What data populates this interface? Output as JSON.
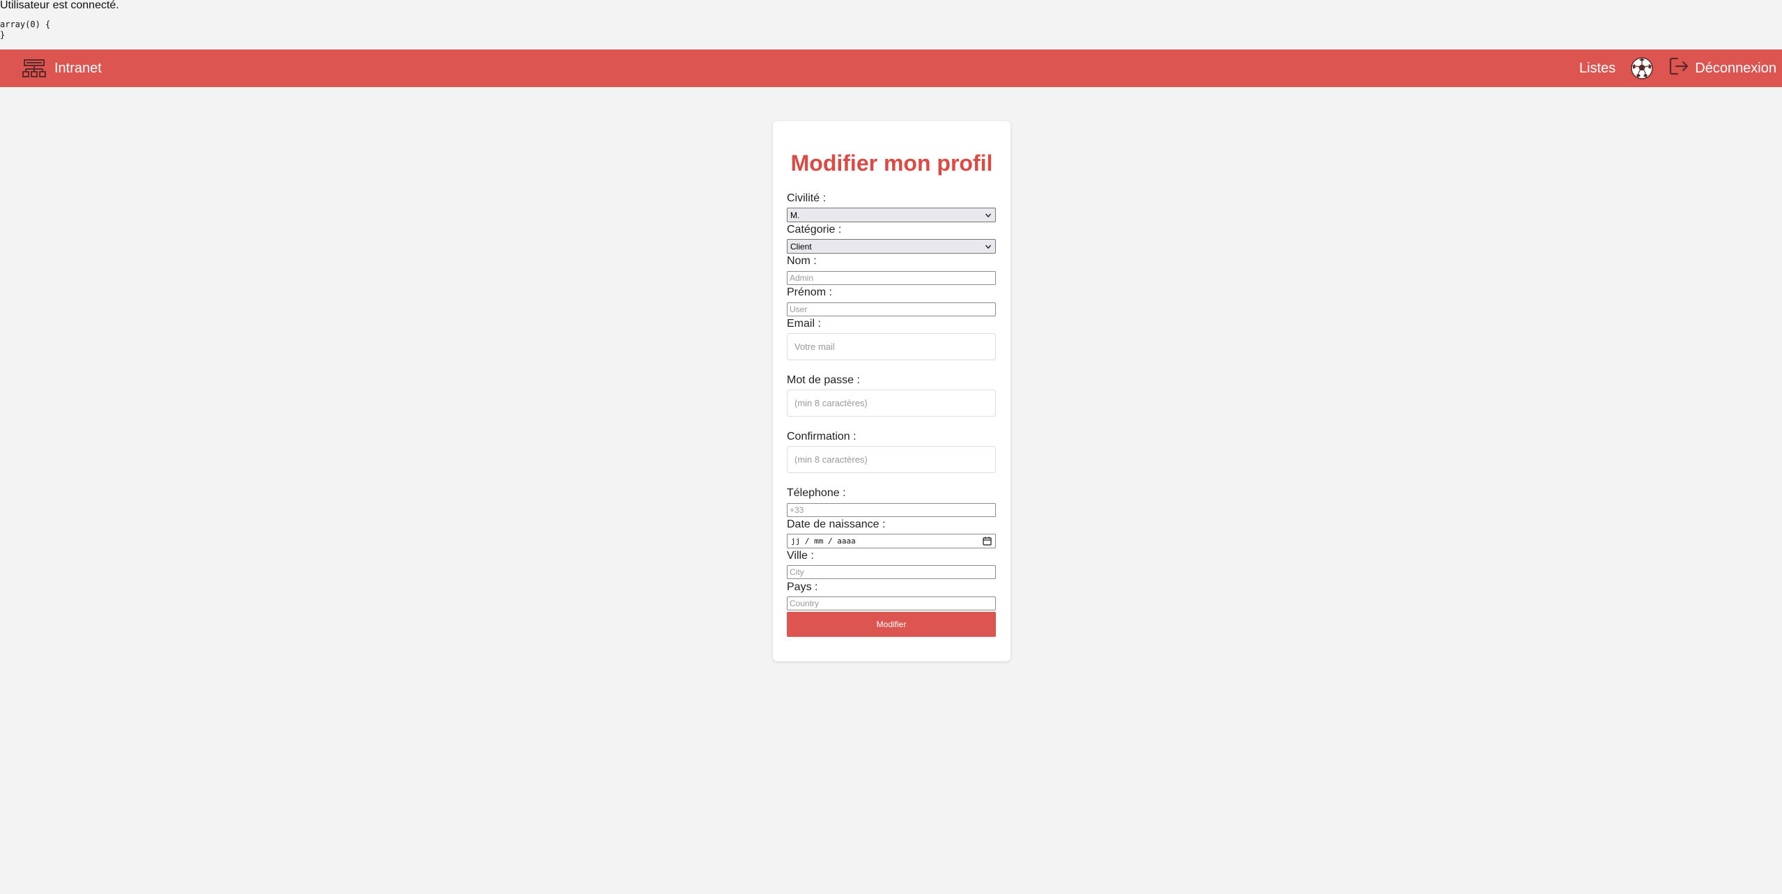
{
  "debug": {
    "status_text": "Utilisateur est connecté.",
    "dump_text": "array(0) {\n}"
  },
  "navbar": {
    "brand_icon": "sitemap-icon",
    "brand_label": "Intranet",
    "lists_label": "Listes",
    "avatar_icon": "soccer-ball-icon",
    "logout_icon": "logout-icon",
    "logout_label": "Déconnexion",
    "background_color": "#dd5550"
  },
  "form": {
    "title": "Modifier mon profil",
    "title_color": "#dd4a44",
    "fields": {
      "civilite": {
        "label": "Civilité :",
        "value": "M."
      },
      "categorie": {
        "label": "Catégorie :",
        "value": "Client"
      },
      "nom": {
        "label": "Nom :",
        "placeholder": "Admin"
      },
      "prenom": {
        "label": "Prénom :",
        "placeholder": "User"
      },
      "email": {
        "label": "Email :",
        "placeholder": "Votre mail"
      },
      "mot_de_passe": {
        "label": "Mot de passe :",
        "placeholder": "(min 8 caractères)"
      },
      "confirmation": {
        "label": "Confirmation :",
        "placeholder": "(min 8 caractères)"
      },
      "telephone": {
        "label": "Télephone :",
        "placeholder": "+33"
      },
      "date_naissance": {
        "label": "Date de naissance :",
        "placeholder": "jj / mm / aaaa"
      },
      "ville": {
        "label": "Ville :",
        "placeholder": "City"
      },
      "pays": {
        "label": "Pays :",
        "placeholder": "Country"
      }
    },
    "submit_label": "Modifier",
    "submit_color": "#dd5550"
  }
}
